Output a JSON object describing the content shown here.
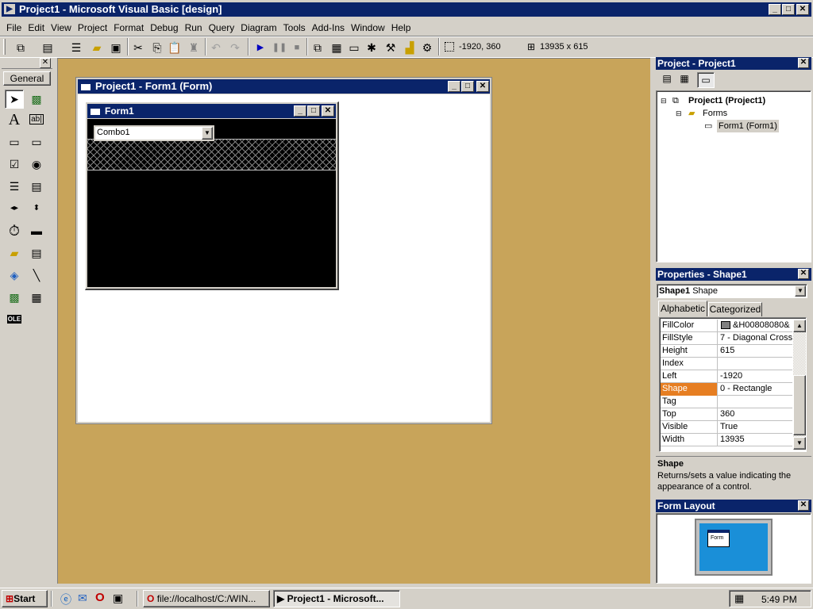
{
  "app": {
    "title": "Project1 - Microsoft Visual Basic [design]"
  },
  "menu": [
    "File",
    "Edit",
    "View",
    "Project",
    "Format",
    "Debug",
    "Run",
    "Query",
    "Diagram",
    "Tools",
    "Add-Ins",
    "Window",
    "Help"
  ],
  "toolbar": {
    "position": "-1920, 360",
    "size": "13935 x 615"
  },
  "toolbox": {
    "tab_label": "General",
    "ole_label": "OLE",
    "text_label": "ab|"
  },
  "designer": {
    "window_title": "Project1 - Form1 (Form)",
    "form_title": "Form1",
    "combo_text": "Combo1"
  },
  "project_explorer": {
    "title": "Project - Project1",
    "root": "Project1 (Project1)",
    "folder": "Forms",
    "item": "Form1 (Form1)"
  },
  "properties": {
    "title": "Properties - Shape1",
    "object_name": "Shape1",
    "object_type": "Shape",
    "tab_alphabetic": "Alphabetic",
    "tab_categorized": "Categorized",
    "rows": [
      {
        "name": "FillColor",
        "value": "&H00808080&"
      },
      {
        "name": "FillStyle",
        "value": "7 - Diagonal Cross"
      },
      {
        "name": "Height",
        "value": "615"
      },
      {
        "name": "Index",
        "value": ""
      },
      {
        "name": "Left",
        "value": "-1920"
      },
      {
        "name": "Shape",
        "value": "0 - Rectangle"
      },
      {
        "name": "Tag",
        "value": ""
      },
      {
        "name": "Top",
        "value": "360"
      },
      {
        "name": "Visible",
        "value": "True"
      },
      {
        "name": "Width",
        "value": "13935"
      }
    ],
    "selected_row": "Shape",
    "desc_title": "Shape",
    "desc_text": "Returns/sets a value indicating the appearance of a control."
  },
  "form_layout": {
    "title": "Form Layout",
    "form_label": "Form"
  },
  "taskbar": {
    "start": "Start",
    "btn1": "file://localhost/C:/WIN...",
    "btn2": "Project1 - Microsoft...",
    "clock": "5:49 PM"
  },
  "colors": {
    "workspace": "#c8a45a",
    "titlebar": "#0a246a",
    "selected": "#e67e22",
    "form_layout_screen": "#1a8fd8"
  }
}
